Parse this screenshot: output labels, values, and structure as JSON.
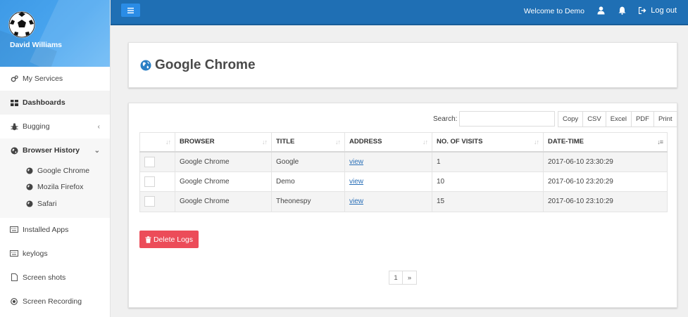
{
  "user": {
    "name": "David Williams"
  },
  "sidebar": {
    "items": [
      {
        "label": "My Services",
        "icon": "gears-icon"
      },
      {
        "label": "Dashboards",
        "icon": "dashboard-icon"
      },
      {
        "label": "Bugging",
        "icon": "bug-icon"
      },
      {
        "label": "Browser History",
        "icon": "globe-icon"
      },
      {
        "label": "Installed Apps",
        "icon": "keyboard-icon"
      },
      {
        "label": "keylogs",
        "icon": "keyboard-icon"
      },
      {
        "label": "Screen shots",
        "icon": "file-icon"
      },
      {
        "label": "Screen Recording",
        "icon": "record-icon"
      }
    ],
    "browser_sub": [
      {
        "label": "Google Chrome"
      },
      {
        "label": "Mozila Firefox"
      },
      {
        "label": "Safari"
      }
    ]
  },
  "topbar": {
    "welcome": "Welcome to Demo",
    "logout": "Log out",
    "color": "#1f6fb4"
  },
  "page": {
    "title": "Google Chrome"
  },
  "table": {
    "search_label": "Search:",
    "search_value": "",
    "exports": [
      "Copy",
      "CSV",
      "Excel",
      "PDF",
      "Print"
    ],
    "headers": [
      "",
      "BROWSER",
      "TITLE",
      "ADDRESS",
      "NO. OF VISITS",
      "DATE-TIME"
    ],
    "rows": [
      {
        "browser": "Google Chrome",
        "title": "Google",
        "address": "view",
        "visits": "1",
        "datetime": "2017-06-10 23:30:29"
      },
      {
        "browser": "Google Chrome",
        "title": "Demo",
        "address": "view",
        "visits": "10",
        "datetime": "2017-06-10 23:20:29"
      },
      {
        "browser": "Google Chrome",
        "title": "Theonespy",
        "address": "view",
        "visits": "15",
        "datetime": "2017-06-10 23:10:29"
      }
    ]
  },
  "actions": {
    "delete_label": "Delete Logs",
    "delete_color": "#ec4c59"
  },
  "pagination": {
    "current": "1",
    "next": "»"
  }
}
